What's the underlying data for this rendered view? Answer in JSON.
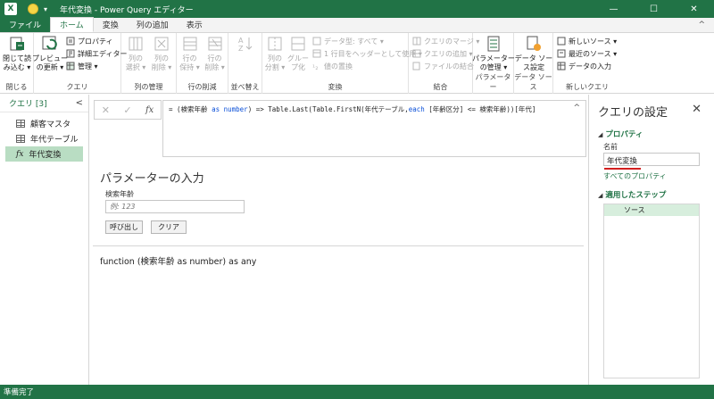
{
  "titlebar": {
    "app_icon": "X",
    "quick_access": "▾",
    "title": "年代変換 - Power Query エディター",
    "minimize": "—",
    "maximize": "☐",
    "close": "✕"
  },
  "tabs": [
    {
      "label": "ファイル"
    },
    {
      "label": "ホーム"
    },
    {
      "label": "変換"
    },
    {
      "label": "列の追加"
    },
    {
      "label": "表示"
    }
  ],
  "ribbon_collapse": "^",
  "ribbon": {
    "close_group": {
      "label": "閉じる",
      "close_load": "閉じて読\nみ込む ▾"
    },
    "query_group": {
      "label": "クエリ",
      "preview_refresh": "プレビュー\nの更新 ▾",
      "properties": "プロパティ",
      "advanced_editor": "詳細エディター",
      "manage": "管理 ▾"
    },
    "columns_group": {
      "label": "列の管理",
      "choose_columns": "列の\n選択 ▾",
      "remove_columns": "列の\n削除 ▾"
    },
    "rows_group": {
      "label": "行の削減",
      "keep_rows": "行の\n保持 ▾",
      "remove_rows": "行の\n削除 ▾"
    },
    "sort_group": {
      "label": "並べ替え"
    },
    "transform_group": {
      "label": "変換",
      "split_column": "列の\n分割 ▾",
      "group_by": "グルー\nプ化",
      "data_type": "データ型: すべて ▾",
      "first_row_header": "1 行目をヘッダーとして使用 ▾",
      "replace_values": "値の置換"
    },
    "combine_group": {
      "label": "結合",
      "merge_queries": "クエリのマージ ▾",
      "append_queries": "クエリの追加 ▾",
      "combine_files": "ファイルの結合"
    },
    "params_group": {
      "label": "パラメーター",
      "manage_params": "パラメーター\nの管理 ▾"
    },
    "datasource_group": {
      "label": "データ ソース",
      "datasource_settings": "データ ソー\nス設定"
    },
    "newquery_group": {
      "label": "新しいクエリ",
      "new_source": "新しいソース ▾",
      "recent_sources": "最近のソース ▾",
      "enter_data": "データの入力"
    }
  },
  "queries_pane": {
    "header": "クエリ [3]",
    "collapse": "<",
    "items": [
      {
        "label": "顧客マスタ",
        "icon": "table-icon"
      },
      {
        "label": "年代テーブル",
        "icon": "table-icon"
      },
      {
        "label": "年代変換",
        "icon": "function-icon"
      }
    ]
  },
  "formula_bar": {
    "cancel": "✕",
    "confirm": "✓",
    "fx": "fx",
    "expand": "^",
    "seg1": "= (検索年齢 ",
    "seg2": "as",
    "seg3": " ",
    "seg4": "number",
    "seg5": ") =>  Table.Last(Table.FirstN(年代テーブル,",
    "seg6": "each",
    "seg7": " [年齢区分] <= 検索年齢))[年代]"
  },
  "parameter": {
    "title": "パラメーターの入力",
    "label": "検索年齢",
    "placeholder": "例: 123",
    "invoke": "呼び出し",
    "clear": "クリア"
  },
  "function_signature": "function (検索年齢 as number) as any",
  "settings_pane": {
    "title": "クエリの設定",
    "close": "✕",
    "properties_header": "プロパティ",
    "name_label": "名前",
    "name_value": "年代変換",
    "all_properties": "すべてのプロパティ",
    "steps_header": "適用したステップ",
    "steps": [
      {
        "label": "ソース"
      }
    ]
  },
  "statusbar": {
    "text": "準備完了"
  },
  "colors": {
    "accent": "#217346",
    "selected": "#b9ddc3",
    "underline": "#d21e1e"
  }
}
